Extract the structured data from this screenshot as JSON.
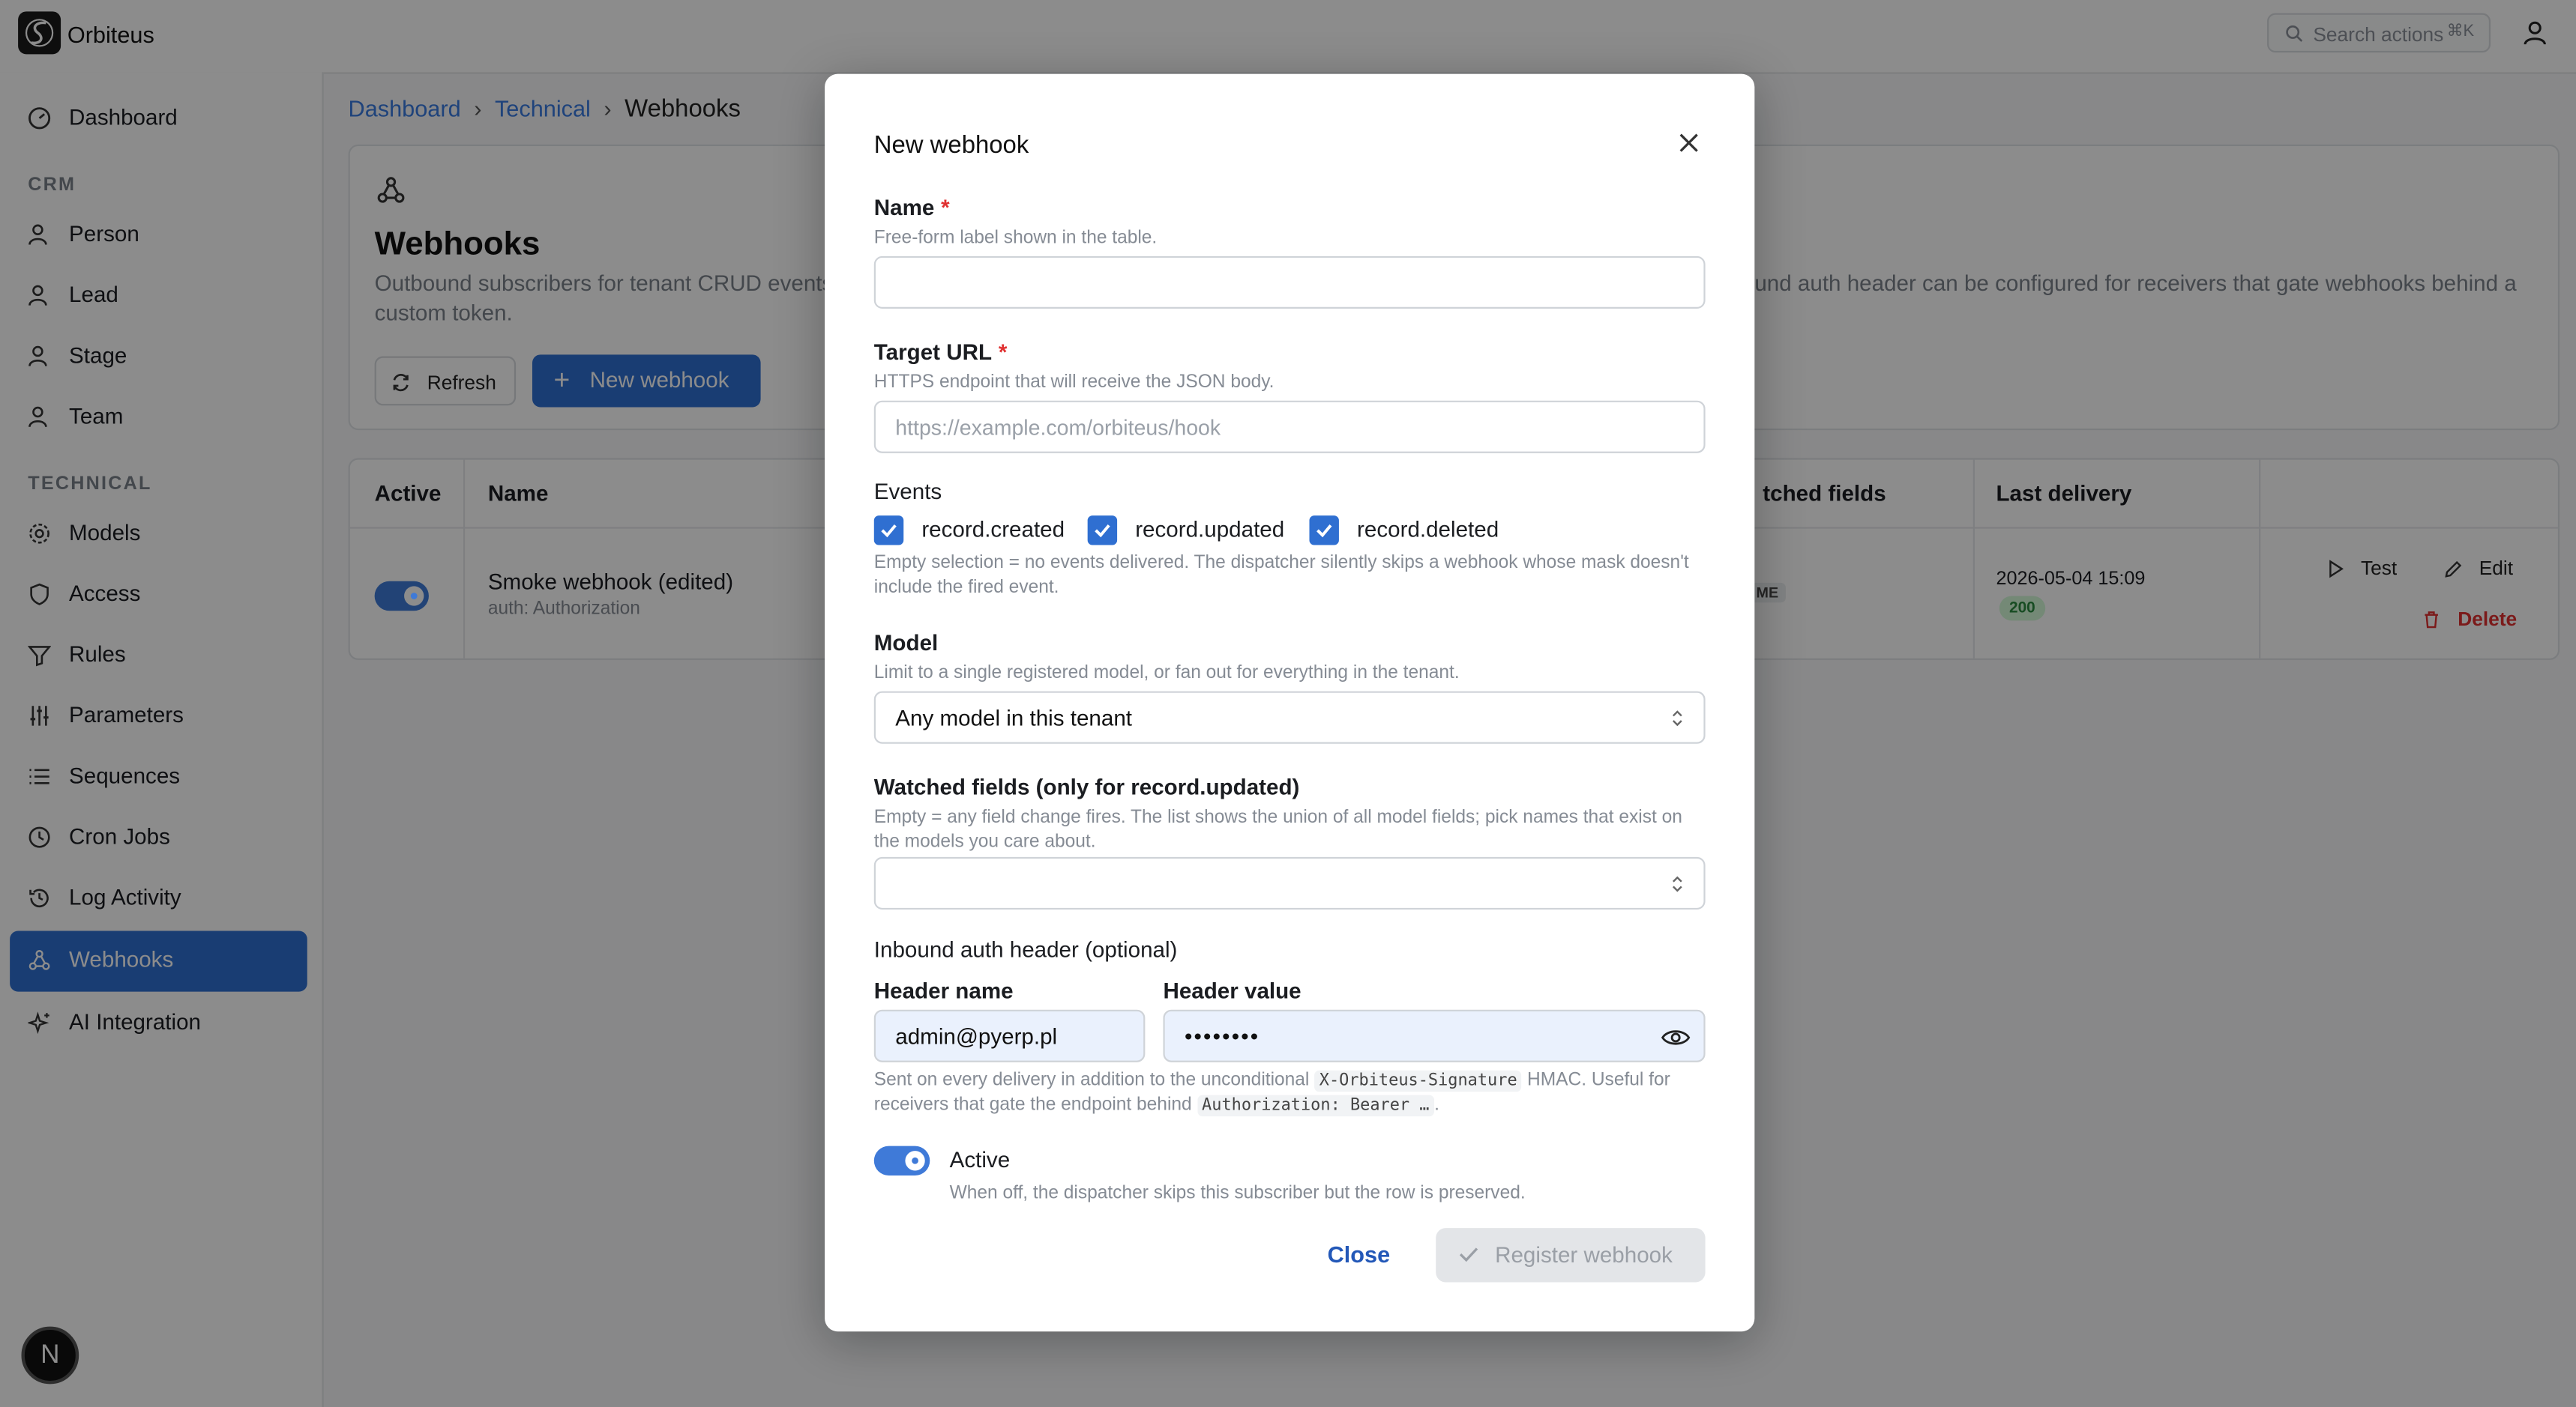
{
  "app": {
    "name": "Orbiteus"
  },
  "search": {
    "placeholder": "Search actions",
    "shortcut": "⌘K"
  },
  "sidebar": {
    "top_items": [
      {
        "label": "Dashboard",
        "icon": "dashboard-icon"
      }
    ],
    "crm_label": "CRM",
    "crm_items": [
      {
        "label": "Person",
        "icon": "person-icon"
      },
      {
        "label": "Lead",
        "icon": "person-icon"
      },
      {
        "label": "Stage",
        "icon": "person-icon"
      },
      {
        "label": "Team",
        "icon": "person-icon"
      }
    ],
    "technical_label": "TECHNICAL",
    "technical_items": [
      {
        "label": "Models",
        "icon": "gear-icon"
      },
      {
        "label": "Access",
        "icon": "shield-icon"
      },
      {
        "label": "Rules",
        "icon": "filter-icon"
      },
      {
        "label": "Parameters",
        "icon": "sliders-icon"
      },
      {
        "label": "Sequences",
        "icon": "list-icon"
      },
      {
        "label": "Cron Jobs",
        "icon": "clock-icon"
      },
      {
        "label": "Log Activity",
        "icon": "history-icon"
      },
      {
        "label": "Webhooks",
        "icon": "webhook-icon",
        "active": true
      },
      {
        "label": "AI Integration",
        "icon": "sparkle-icon"
      }
    ],
    "avatar_letter": "N"
  },
  "breadcrumb": {
    "items": [
      "Dashboard",
      "Technical"
    ],
    "current": "Webhooks"
  },
  "page": {
    "title": "Webhooks",
    "description_part1": "Outbound subscribers for tenant CRUD events",
    "description_part2": "und auth header can be configured for receivers that gate webhooks behind a",
    "description_part3": "custom token.",
    "refresh_label": "Refresh",
    "new_label": "New webhook"
  },
  "table": {
    "columns": [
      "Active",
      "Name",
      "tched fields",
      "Last delivery"
    ],
    "rows": [
      {
        "active": true,
        "name": "Smoke webhook (edited)",
        "subtitle": "auth: Authorization",
        "watched_badge": "ME",
        "last_delivery": "2026-05-04 15:09",
        "status_code": "200",
        "actions": {
          "test": "Test",
          "edit": "Edit",
          "delete": "Delete"
        }
      }
    ]
  },
  "modal": {
    "title": "New webhook",
    "name": {
      "label": "Name",
      "hint": "Free-form label shown in the table.",
      "value": ""
    },
    "target_url": {
      "label": "Target URL",
      "hint": "HTTPS endpoint that will receive the JSON body.",
      "placeholder": "https://example.com/orbiteus/hook"
    },
    "events": {
      "label": "Events",
      "options": [
        {
          "label": "record.created",
          "checked": true
        },
        {
          "label": "record.updated",
          "checked": true
        },
        {
          "label": "record.deleted",
          "checked": true
        }
      ],
      "hint": "Empty selection = no events delivered. The dispatcher silently skips a webhook whose mask doesn't include the fired event."
    },
    "model": {
      "label": "Model",
      "hint": "Limit to a single registered model, or fan out for everything in the tenant.",
      "value": "Any model in this tenant"
    },
    "watched_fields": {
      "label": "Watched fields (only for record.updated)",
      "hint": "Empty = any field change fires. The list shows the union of all model fields; pick names that exist on the models you care about.",
      "value": ""
    },
    "auth": {
      "section_label": "Inbound auth header (optional)",
      "header_name_label": "Header name",
      "header_name_value": "admin@pyerp.pl",
      "header_value_label": "Header value",
      "header_value_masked": "••••••••",
      "hint_pre": "Sent on every delivery in addition to the unconditional",
      "hint_code1": "X-Orbiteus-Signature",
      "hint_mid": "HMAC. Useful for receivers that gate the endpoint behind",
      "hint_code2": "Authorization: Bearer …",
      "hint_post": "."
    },
    "active": {
      "label": "Active",
      "hint": "When off, the dispatcher skips this subscriber but the row is preserved.",
      "on": true
    },
    "close_label": "Close",
    "register_label": "Register webhook"
  }
}
